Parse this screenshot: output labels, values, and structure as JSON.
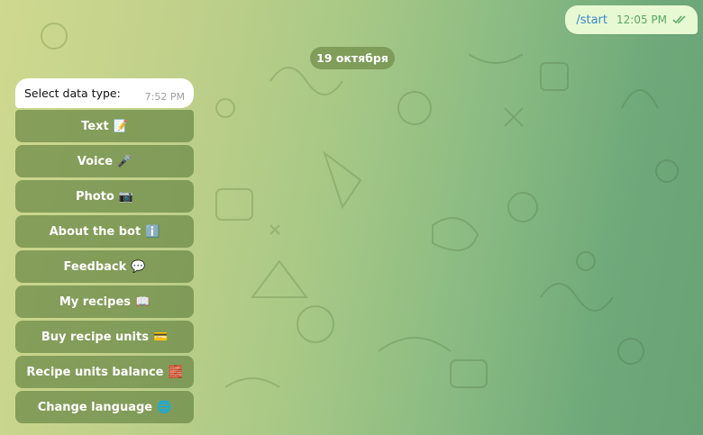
{
  "outgoing": {
    "text": "/start",
    "time": "12:05 PM",
    "status_icon": "double-check-icon"
  },
  "date_separator": "19 октября",
  "incoming": {
    "text": "Select data type:",
    "time": "7:52 PM"
  },
  "keyboard": [
    {
      "label": "Text",
      "emoji": "📝"
    },
    {
      "label": "Voice",
      "emoji": "🎤"
    },
    {
      "label": "Photo",
      "emoji": "📷"
    },
    {
      "label": "About the bot",
      "emoji": "ℹ️"
    },
    {
      "label": "Feedback",
      "emoji": "💬"
    },
    {
      "label": "My recipes",
      "emoji": "📖"
    },
    {
      "label": "Buy recipe units",
      "emoji": "💳"
    },
    {
      "label": "Recipe units balance",
      "emoji": "🧱"
    },
    {
      "label": "Change language",
      "emoji": "🌐"
    }
  ]
}
